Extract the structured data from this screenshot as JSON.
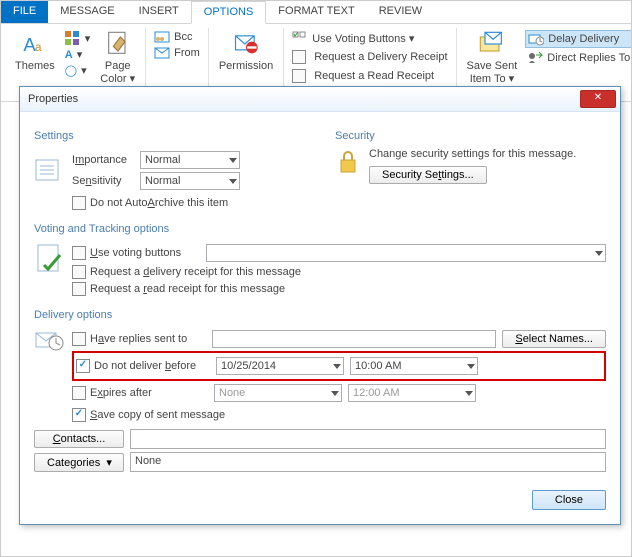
{
  "tabs": {
    "file": "FILE",
    "message": "MESSAGE",
    "insert": "INSERT",
    "options": "OPTIONS",
    "format": "FORMAT TEXT",
    "review": "REVIEW"
  },
  "ribbon": {
    "themes": "Themes",
    "pageColor": "Page\nColor ▾",
    "bcc": "Bcc",
    "from": "From",
    "permission": "Permission",
    "voting": "Use Voting Buttons ▾",
    "reqDelivery": "Request a Delivery Receipt",
    "reqRead": "Request a Read Receipt",
    "saveSent": "Save Sent\nItem To ▾",
    "delay": "Delay Delivery",
    "direct": "Direct Replies To"
  },
  "dlg": {
    "title": "Properties",
    "settings": {
      "legend": "Settings",
      "importance": "Importance",
      "importanceVal": "Normal",
      "sensitivity": "Sensitivity",
      "sensitivityVal": "Normal",
      "noArchive": "Do not AutoArchive this item"
    },
    "security": {
      "legend": "Security",
      "msg": "Change security settings for this message.",
      "btn": "Security Settings..."
    },
    "voting": {
      "legend": "Voting and Tracking options",
      "useVoting": "Use voting buttons",
      "useVotingU": "b",
      "reqDel": "Request a delivery receipt for this message",
      "reqDelU": "d",
      "reqRead": "Request a read receipt for this message",
      "reqReadU": "r"
    },
    "delivery": {
      "legend": "Delivery options",
      "haveReplies": "Have replies sent to",
      "selNames": "Select Names...",
      "selNamesU": "S",
      "noDeliver": "Do not deliver before",
      "noDeliverU": "b",
      "date": "10/25/2014",
      "time": "10:00 AM",
      "expires": "Expires after",
      "expiresU": "x",
      "expDate": "None",
      "expTime": "12:00 AM",
      "saveCopy": "Save copy of sent message",
      "saveCopyU": "S",
      "contacts": "Contacts...",
      "contactsU": "C",
      "categories": "Categories   ▾",
      "categoriesU": "g",
      "categoriesVal": "None"
    },
    "close": "Close"
  }
}
